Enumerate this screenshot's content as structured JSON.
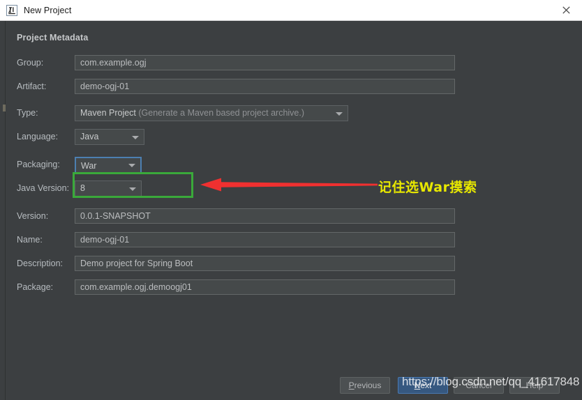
{
  "window": {
    "title": "New Project",
    "icon": "intellij-idea-icon",
    "close_label": "×"
  },
  "dialog": {
    "section_title": "Project Metadata"
  },
  "form": {
    "fields": [
      {
        "name": "group",
        "label": "Group:",
        "value": "com.example.ogj",
        "kind": "text"
      },
      {
        "name": "artifact",
        "label": "Artifact:",
        "value": "demo-ogj-01",
        "kind": "text"
      },
      {
        "name": "type",
        "label": "Type:",
        "value": "Maven Project",
        "hint": "(Generate a Maven based project archive.)",
        "kind": "combo"
      },
      {
        "name": "language",
        "label": "Language:",
        "value": "Java",
        "kind": "combo"
      },
      {
        "name": "packaging",
        "label": "Packaging:",
        "value": "War",
        "kind": "combo"
      },
      {
        "name": "javaversion",
        "label": "Java Version:",
        "value": "8",
        "kind": "combo"
      },
      {
        "name": "version",
        "label": "Version:",
        "value": "0.0.1-SNAPSHOT",
        "kind": "text"
      },
      {
        "name": "projectname",
        "label": "Name:",
        "value": "demo-ogj-01",
        "kind": "text"
      },
      {
        "name": "description",
        "label": "Description:",
        "value": "Demo project for Spring Boot",
        "kind": "text"
      },
      {
        "name": "package",
        "label": "Package:",
        "value": "com.example.ogj.demoogj01",
        "kind": "text"
      }
    ]
  },
  "annotation": {
    "note_text": "记住选War摸索",
    "note_color": "#e8e800",
    "highlight_color": "#3aa93a",
    "arrow_color": "#f03030"
  },
  "buttons": {
    "previous_prefix": "P",
    "previous_rest": "revious",
    "next_prefix": "N",
    "next_rest": "ext",
    "cancel": "Cancel",
    "help": "Help"
  },
  "watermark": {
    "text": "https://blog.csdn.net/qq_41617848"
  },
  "colors": {
    "dialog_background": "#3c3f41",
    "field_background": "#45494a",
    "accent_blue": "#365880",
    "focus_blue": "#4c7fb1"
  }
}
